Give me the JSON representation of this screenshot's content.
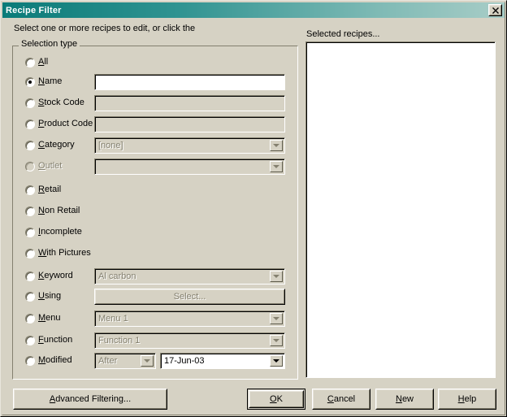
{
  "window": {
    "title": "Recipe Filter",
    "close_icon": "close-icon",
    "close_label": "✕"
  },
  "instruction": "Select one or more recipes to edit, or click the",
  "group": {
    "legend": "Selection type"
  },
  "right_panel": {
    "label": "Selected recipes...",
    "items": []
  },
  "rows": [
    {
      "name": "all",
      "label_pre": "",
      "accel": "A",
      "label_post": "ll",
      "selected": false,
      "enabled": true,
      "control": "none"
    },
    {
      "name": "name",
      "label_pre": "",
      "accel": "N",
      "label_post": "ame",
      "selected": true,
      "enabled": true,
      "control": "text",
      "value": "",
      "field_enabled": true
    },
    {
      "name": "stock-code",
      "label_pre": "",
      "accel": "S",
      "label_post": "tock Code",
      "selected": false,
      "enabled": true,
      "control": "text",
      "value": "",
      "field_enabled": false
    },
    {
      "name": "product-code",
      "label_pre": "",
      "accel": "P",
      "label_post": "roduct Code",
      "selected": false,
      "enabled": true,
      "control": "text",
      "value": "",
      "field_enabled": false
    },
    {
      "name": "category",
      "label_pre": "",
      "accel": "C",
      "label_post": "ategory",
      "selected": false,
      "enabled": true,
      "control": "combo",
      "value": "[none]",
      "field_enabled": false
    },
    {
      "name": "outlet",
      "label_pre": "",
      "accel": "O",
      "label_post": "utlet",
      "selected": false,
      "enabled": false,
      "control": "combo",
      "value": "",
      "field_enabled": false
    },
    {
      "name": "retail",
      "label_pre": "",
      "accel": "R",
      "label_post": "etail",
      "selected": false,
      "enabled": true,
      "control": "none"
    },
    {
      "name": "non-retail",
      "label_pre": "",
      "accel": "N",
      "label_post": "on Retail",
      "selected": false,
      "enabled": true,
      "control": "none"
    },
    {
      "name": "incomplete",
      "label_pre": "",
      "accel": "I",
      "label_post": "ncomplete",
      "selected": false,
      "enabled": true,
      "control": "none"
    },
    {
      "name": "with-pictures",
      "label_pre": "",
      "accel": "W",
      "label_post": "ith Pictures",
      "selected": false,
      "enabled": true,
      "control": "none"
    },
    {
      "name": "keyword",
      "label_pre": "",
      "accel": "K",
      "label_post": "eyword",
      "selected": false,
      "enabled": true,
      "control": "combo",
      "value": "Al carbon",
      "field_enabled": false
    },
    {
      "name": "using",
      "label_pre": "",
      "accel": "U",
      "label_post": "sing",
      "selected": false,
      "enabled": true,
      "control": "button",
      "value": "Select...",
      "field_enabled": false
    },
    {
      "name": "menu",
      "label_pre": "",
      "accel": "M",
      "label_post": "enu",
      "selected": false,
      "enabled": true,
      "control": "combo",
      "value": "Menu 1",
      "field_enabled": false
    },
    {
      "name": "function",
      "label_pre": "",
      "accel": "F",
      "label_post": "unction",
      "selected": false,
      "enabled": true,
      "control": "combo",
      "value": "Function 1",
      "field_enabled": false
    },
    {
      "name": "modified",
      "label_pre": "",
      "accel": "M",
      "label_post": "odified",
      "selected": false,
      "enabled": true,
      "control": "date",
      "value": "After",
      "date_value": "17-Jun-03",
      "field_enabled": false,
      "date_enabled": true
    }
  ],
  "buttons": {
    "advanced_pre": "",
    "advanced_accel": "A",
    "advanced_post": "dvanced Filtering...",
    "ok_pre": "",
    "ok_accel": "O",
    "ok_post": "K",
    "cancel_pre": "",
    "cancel_accel": "C",
    "cancel_post": "ancel",
    "new_pre": "",
    "new_accel": "N",
    "new_post": "ew",
    "help_pre": "",
    "help_accel": "H",
    "help_post": "elp"
  },
  "colors": {
    "face": "#d6d2c4",
    "title_left": "#0a7b79",
    "title_right": "#a8cdc7",
    "window_bg": "#ffffff",
    "disabled_text": "#84806f"
  }
}
